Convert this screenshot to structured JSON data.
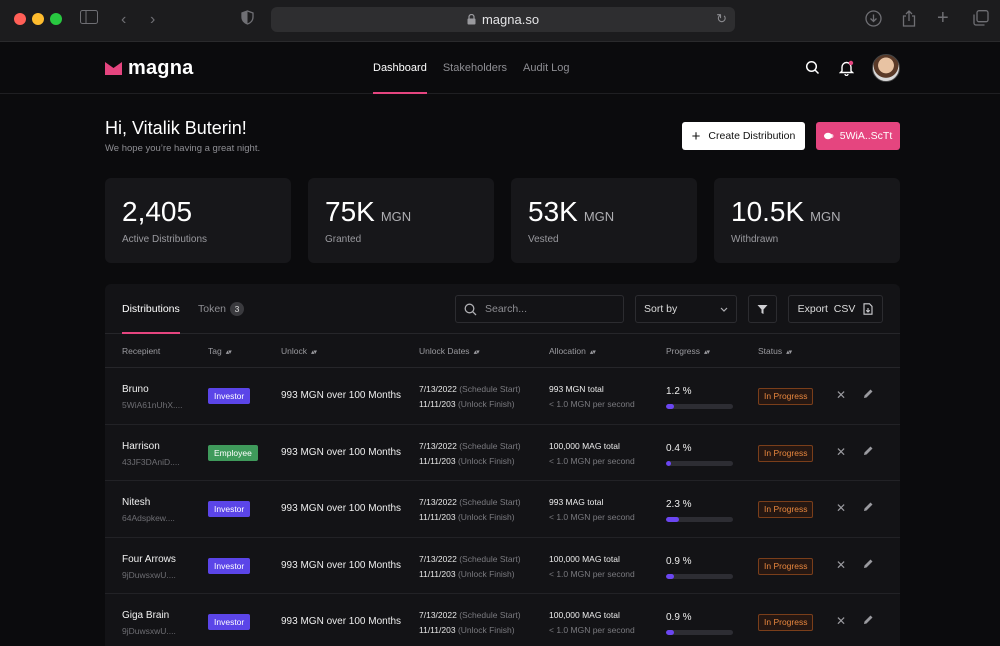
{
  "browser": {
    "url": "magna.so"
  },
  "brand": {
    "name": "magna",
    "accent": "#e5457f"
  },
  "nav": {
    "links": [
      "Dashboard",
      "Stakeholders",
      "Audit Log"
    ],
    "active": "Dashboard"
  },
  "greeting": {
    "title": "Hi, Vitalik Buterin!",
    "subtitle": "We hope you’re having a great night."
  },
  "actions": {
    "create_label": "Create Distribution",
    "wallet_label": "5WiA..ScTt"
  },
  "stats": [
    {
      "value": "2,405",
      "unit": "",
      "label": "Active Distributions"
    },
    {
      "value": "75K",
      "unit": "MGN",
      "label": "Granted"
    },
    {
      "value": "53K",
      "unit": "MGN",
      "label": "Vested"
    },
    {
      "value": "10.5K",
      "unit": "MGN",
      "label": "Withdrawn"
    }
  ],
  "tabs": {
    "distributions": "Distributions",
    "token": "Token",
    "token_count": "3"
  },
  "toolbar": {
    "search_placeholder": "Search...",
    "sort_label": "Sort by",
    "export_label": "Export  CSV"
  },
  "columns": [
    "Recepient",
    "Tag",
    "Unlock",
    "Unlock Dates",
    "Allocation",
    "Progress",
    "Status"
  ],
  "rows": [
    {
      "name": "Bruno",
      "address": "5WiA61nUhX....",
      "tag": "Investor",
      "tag_color": "#5b45e8",
      "unlock": "993 MGN over 100 Months",
      "start": "7/13/2022",
      "start_note": "(Schedule Start)",
      "finish": "11/11/203",
      "finish_note": "(Unlock Finish)",
      "alloc_total": "993 MGN total",
      "alloc_rate": "< 1.0 MGN per second",
      "progress_text": "1.2 %",
      "progress": 0.12,
      "status": "In Progress"
    },
    {
      "name": "Harrison",
      "address": "43JF3DAniD....",
      "tag": "Employee",
      "tag_color": "#3f9a5b",
      "unlock": "993 MGN over 100 Months",
      "start": "7/13/2022",
      "start_note": "(Schedule Start)",
      "finish": "11/11/203",
      "finish_note": "(Unlock Finish)",
      "alloc_total": "100,000 MAG total",
      "alloc_rate": "< 1.0 MGN per second",
      "progress_text": "0.4 %",
      "progress": 0.08,
      "status": "In Progress"
    },
    {
      "name": "Nitesh",
      "address": "64Adspkew....",
      "tag": "Investor",
      "tag_color": "#5b45e8",
      "unlock": "993 MGN over 100 Months",
      "start": "7/13/2022",
      "start_note": "(Schedule Start)",
      "finish": "11/11/203",
      "finish_note": "(Unlock Finish)",
      "alloc_total": "993 MAG total",
      "alloc_rate": "< 1.0 MGN per second",
      "progress_text": "2.3 %",
      "progress": 0.2,
      "status": "In Progress"
    },
    {
      "name": "Four Arrows",
      "address": "9jDuwsxwU....",
      "tag": "Investor",
      "tag_color": "#5b45e8",
      "unlock": "993 MGN over 100 Months",
      "start": "7/13/2022",
      "start_note": "(Schedule Start)",
      "finish": "11/11/203",
      "finish_note": "(Unlock Finish)",
      "alloc_total": "100,000 MAG total",
      "alloc_rate": "< 1.0 MGN per second",
      "progress_text": "0.9 %",
      "progress": 0.12,
      "status": "In Progress"
    },
    {
      "name": "Giga Brain",
      "address": "9jDuwsxwU....",
      "tag": "Investor",
      "tag_color": "#5b45e8",
      "unlock": "993 MGN over 100 Months",
      "start": "7/13/2022",
      "start_note": "(Schedule Start)",
      "finish": "11/11/203",
      "finish_note": "(Unlock Finish)",
      "alloc_total": "100,000 MAG total",
      "alloc_rate": "< 1.0 MGN per second",
      "progress_text": "0.9 %",
      "progress": 0.12,
      "status": "In Progress"
    }
  ]
}
